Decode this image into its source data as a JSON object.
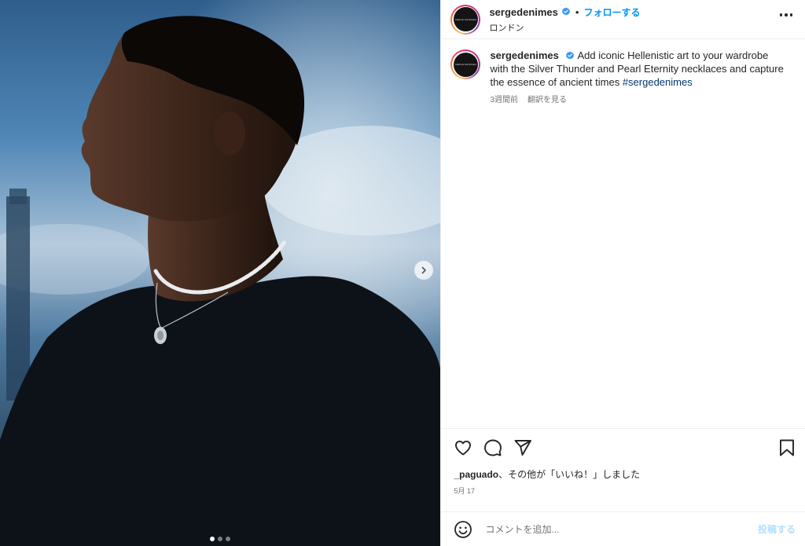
{
  "header": {
    "username": "sergedenimes",
    "separator": "•",
    "follow_label": "フォローする",
    "location": "ロンドン",
    "avatar_text": "SERGE DENIMES"
  },
  "caption": {
    "username": "sergedenimes",
    "text": "Add iconic Hellenistic art to your wardrobe with the Silver Thunder and Pearl Eternity necklaces and capture the essence of ancient times ",
    "hashtag": "#sergedenimes",
    "time_ago": "3週間前",
    "translate_label": "翻訳を見る"
  },
  "likes": {
    "user": "_paguado",
    "suffix": "、その他が「いいね！」しました"
  },
  "date": "5月 17",
  "comment_box": {
    "placeholder": "コメントを追加...",
    "post_label": "投稿する"
  },
  "carousel": {
    "total": 3,
    "active": 0
  },
  "colors": {
    "accent": "#0095f6",
    "verified": "#3897f0",
    "hashtag": "#00376b",
    "post_disabled": "#b2dffc"
  },
  "icons": {
    "verified": "verified-badge-icon",
    "more": "more-options-icon",
    "next": "chevron-right-icon",
    "like": "heart-icon",
    "comment": "comment-icon",
    "share": "share-icon",
    "save": "bookmark-icon",
    "emoji": "emoji-icon"
  }
}
